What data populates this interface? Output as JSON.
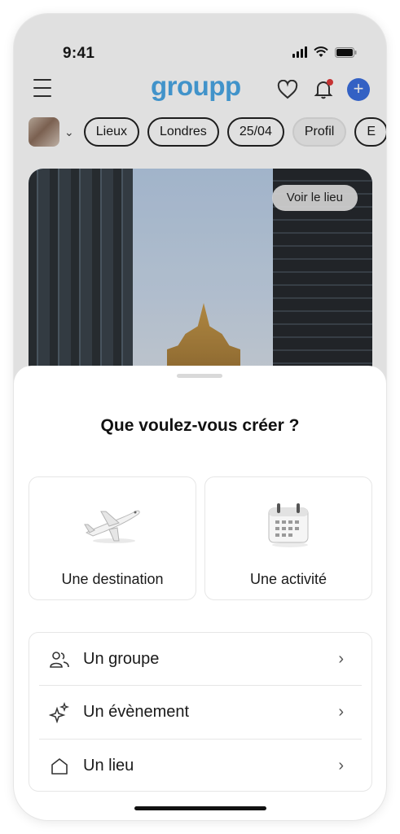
{
  "status_bar": {
    "time": "9:41"
  },
  "header": {
    "logo": "groupp",
    "menu_icon": "menu-icon",
    "favorite_icon": "heart-icon",
    "notification_icon": "bell-icon",
    "add_icon": "plus-icon",
    "add_symbol": "+"
  },
  "filters": {
    "chips": [
      "Lieux",
      "Londres",
      "25/04",
      "Profil",
      "E"
    ]
  },
  "hero": {
    "button_label": "Voir le lieu"
  },
  "sheet": {
    "title": "Que voulez-vous créer ?",
    "cards": [
      {
        "label": "Une destination",
        "icon": "airplane-icon"
      },
      {
        "label": "Une activité",
        "icon": "calendar-icon"
      }
    ],
    "list": [
      {
        "label": "Un groupe",
        "icon": "users-icon"
      },
      {
        "label": "Un évènement",
        "icon": "sparkles-icon"
      },
      {
        "label": "Un lieu",
        "icon": "home-icon"
      }
    ],
    "chevron": "›"
  },
  "colors": {
    "brand": "#4aa8e6",
    "accent_button": "#3b6fe0",
    "notification_dot": "#e23b3b"
  }
}
